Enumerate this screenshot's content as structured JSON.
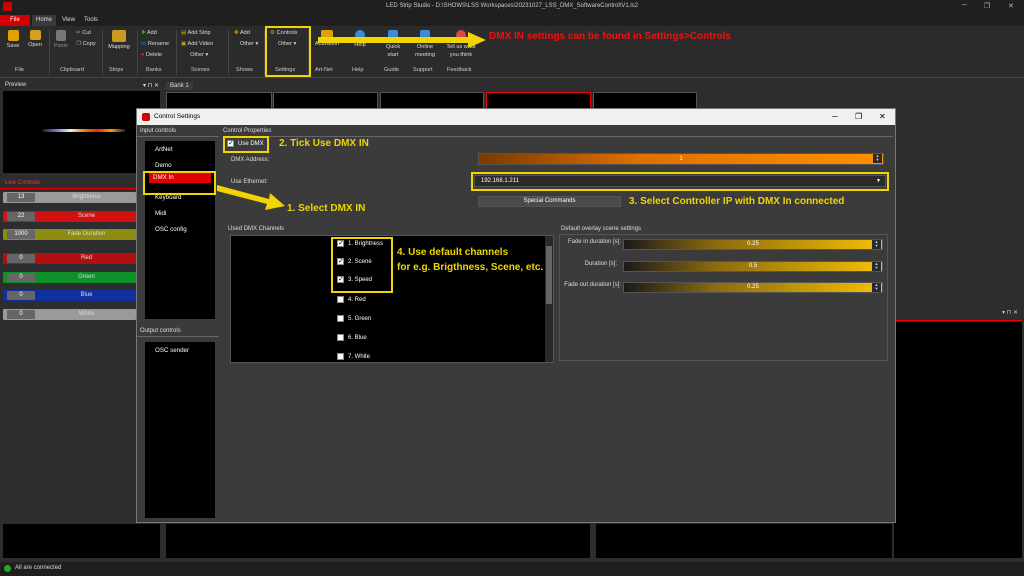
{
  "window": {
    "title": "LED Strip Studio - D:\\SHOWS\\LSS Workspaces\\20231027_LSS_DMX_SoftwareControl\\V1.ls2",
    "minimize": "─",
    "maximize": "❐",
    "close": "✕"
  },
  "tabs": [
    "File",
    "Home",
    "View",
    "Tools"
  ],
  "ribbon": {
    "save": "Save",
    "open": "Open",
    "paste": "Paste",
    "cut": "Cut",
    "copy": "Copy",
    "mapping": "Mapping",
    "add": "Add",
    "rename": "Rename",
    "delete": "Delete",
    "add_strip": "Add Strip",
    "add_video": "Add Video",
    "other_scenes": "Other ▾",
    "add_shows": "Add",
    "other_shows": "Other ▾",
    "controls": "Controls",
    "other_settings": "Other ▾",
    "activation": "Activation",
    "help": "Help",
    "quick_start": "Quick start",
    "online_meeting": "Online meeting",
    "tell_us": "Tell us what you think",
    "groups": {
      "file": "File",
      "clipboard": "Clipboard",
      "strips": "Strips",
      "banks": "Banks",
      "scenes": "Scenes",
      "shows": "Shows",
      "settings": "Settings",
      "artnet": "Art-Net",
      "help": "Help",
      "guide": "Guide",
      "support": "Support",
      "feedback": "Feedback"
    }
  },
  "annotations": {
    "top": "DMX IN settings can be found in Settings>Controls",
    "step1": "1. Select DMX IN",
    "step2": "2. Tick Use DMX IN",
    "step3": "3. Select Controller IP with DMX In connected",
    "step4a": "4. Use default channels",
    "step4b": "for e.g. Brigthness, Scene, etc."
  },
  "preview": {
    "title": "Preview",
    "pin": "▾ ⊓ ✕",
    "bank": "Bank 1"
  },
  "live_controls": {
    "title": "Live Controls",
    "rows": [
      {
        "value": "13",
        "name": "Brightness",
        "color": "#9a9a9a"
      },
      {
        "value": "22",
        "name": "Scene",
        "color": "#d21010"
      },
      {
        "value": "1000",
        "name": "Fade Duration",
        "color": "#8c8c10"
      },
      {
        "value": "0",
        "name": "Red",
        "color": "#b01010"
      },
      {
        "value": "0",
        "name": "Green",
        "color": "#10902a"
      },
      {
        "value": "0",
        "name": "Blue",
        "color": "#1030a0"
      },
      {
        "value": "0",
        "name": "White",
        "color": "#9a9a9a"
      }
    ]
  },
  "dialog": {
    "title": "Control Settings",
    "input_controls": "Input controls",
    "inputs": [
      "ArtNet",
      "Demo",
      "DMX In",
      "Keyboard",
      "Midi",
      "OSC config"
    ],
    "output_controls": "Output controls",
    "outputs": [
      "OSC sender"
    ],
    "control_properties": "Control Properties",
    "use_dmx": "Use DMX",
    "dmx_address_label": "DMX Address:",
    "dmx_address": "1",
    "use_ethernet_label": "Use Ethernet:",
    "ethernet_ip": "192.168.1.211",
    "special_commands": "Special Commands",
    "used_channels": "Used DMX Channels",
    "channels": [
      {
        "label": "1. Brightness",
        "checked": true
      },
      {
        "label": "2. Scene",
        "checked": true
      },
      {
        "label": "3. Speed",
        "checked": true
      },
      {
        "label": "4. Red",
        "checked": false
      },
      {
        "label": "5. Green",
        "checked": false
      },
      {
        "label": "6. Blue",
        "checked": false
      },
      {
        "label": "7. White",
        "checked": false
      }
    ],
    "overlay_title": "Default overlay scene settings",
    "fade_in_label": "Fade in duration [s]:",
    "fade_in": "0.25",
    "duration_label": "Duration [s]:",
    "duration": "0.5",
    "fade_out_label": "Fade out duration [s]:",
    "fade_out": "0.25"
  },
  "status": {
    "text": "All are connected"
  },
  "colors": {
    "accent": "#f0d500",
    "selected": "#e00000",
    "file_tab": "#d40000"
  }
}
